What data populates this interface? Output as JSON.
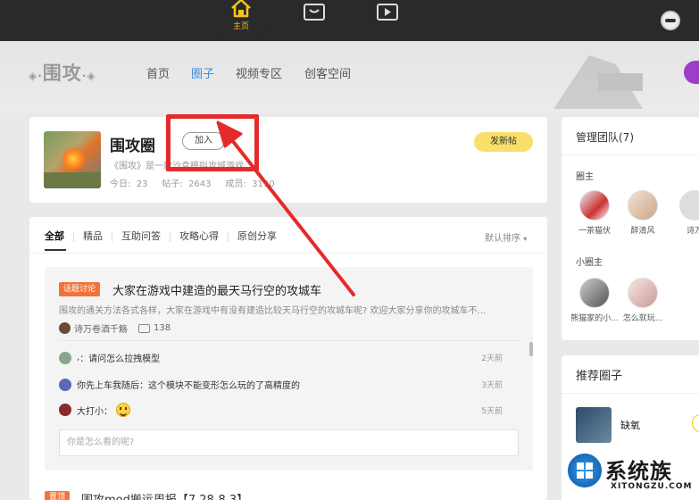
{
  "topnav": {
    "home_label": "主页",
    "colors": {
      "bar": "#2a2a2a",
      "accent": "#f5c518"
    },
    "icons": [
      "home-icon",
      "box-icon",
      "video-icon"
    ]
  },
  "subheader": {
    "logo": "围攻",
    "nav": [
      "首页",
      "圈子",
      "视频专区",
      "创客空间"
    ],
    "active_nav": "圈子"
  },
  "group": {
    "title": "围攻圈",
    "join_label": "加入",
    "description": "《围攻》是一款沙盒模拟攻城游戏",
    "stats": "今日:  23     帖子:  2643     成员:  3190",
    "post_label": "发新帖"
  },
  "feed": {
    "tabs": [
      "全部",
      "精品",
      "互助问答",
      "攻略心得",
      "原创分享"
    ],
    "sort_label": "默认排序",
    "topic": {
      "tag": "话题讨论",
      "title": "大家在游戏中建造的最天马行空的攻城车",
      "description": "围攻的通关方法各式各样，大家在游戏中有没有建造比较天马行空的攻城车呢? 欢迎大家分享你的攻城车不...",
      "author": "诗万卷酒千觞",
      "comment_count": "138",
      "comments": [
        {
          "user": ",",
          "text": "：请问怎么拉拽模型",
          "time": "2天前"
        },
        {
          "user": "你先上车我随后",
          "text": "：这个模块不能变形怎么玩的了高精度的",
          "time": "3天前"
        },
        {
          "user": "大打小",
          "text": "：",
          "time": "5天前"
        }
      ],
      "reply_placeholder": "你是怎么看的呢?"
    },
    "next_post": {
      "tag": "置顶",
      "title": "围攻mod搬运周报【7.28-8.3】"
    }
  },
  "sidebar": {
    "management_title": "管理团队(7)",
    "owner_label": "圈主",
    "owners": [
      "一茶猫伏",
      "醉清风",
      "诗万"
    ],
    "sub_owner_label": "小圈主",
    "sub_owners": [
      "熊猫家的小...",
      "怎么就玩..."
    ],
    "recommend_title": "推荐圈子",
    "recommend": [
      {
        "name": "缺氧"
      }
    ]
  },
  "watermark": {
    "text": "系统族",
    "url": "XITONGZU.COM"
  }
}
